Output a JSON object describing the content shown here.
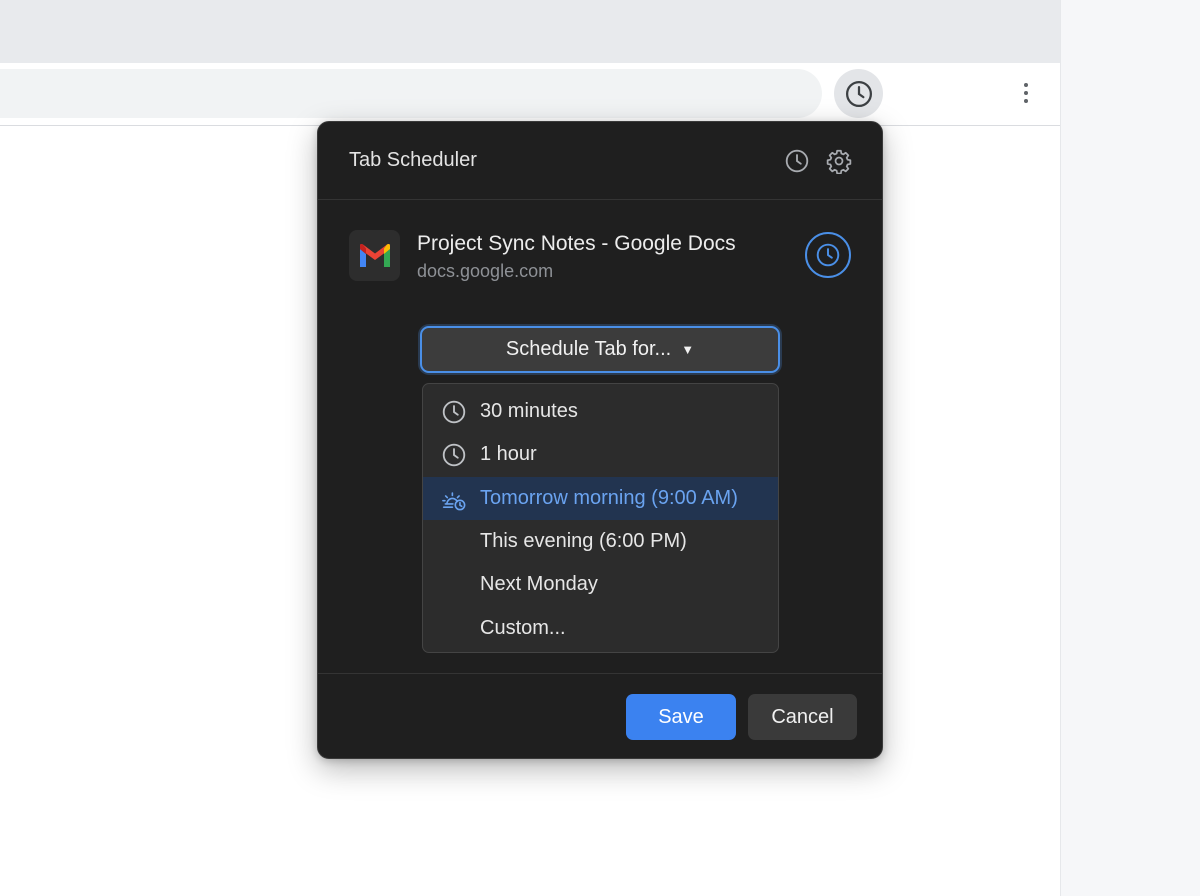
{
  "browser": {
    "extension_icon": "clock-icon",
    "menu_icon": "three-dot-menu-icon"
  },
  "popup": {
    "title": "Tab Scheduler",
    "header_icons": [
      "clock-icon",
      "gear-icon"
    ],
    "tab": {
      "title": "Project Sync Notes - Google Docs",
      "url": "docs.google.com",
      "favicon": "gmail-m-icon"
    },
    "schedule_button": {
      "label": "Schedule Tab for...",
      "caret": "▼"
    },
    "dropdown": {
      "items": [
        {
          "label": "30 minutes",
          "icon": "clock-icon"
        },
        {
          "label": "1 hour",
          "icon": "clock-icon"
        },
        {
          "label": "Tomorrow morning (9:00 AM)",
          "icon": "sunrise-clock-icon",
          "selected": true
        },
        {
          "label": "This evening (6:00 PM)",
          "icon": ""
        },
        {
          "label": "Next Monday",
          "icon": ""
        },
        {
          "label": "Custom...",
          "icon": ""
        }
      ]
    },
    "footer": {
      "save_label": "Save",
      "cancel_label": "Cancel"
    }
  },
  "colors": {
    "accent": "#3b82f0",
    "popup_bg": "#1f1f1f",
    "selected_bg": "#223450",
    "selected_text": "#6aa3f0"
  }
}
